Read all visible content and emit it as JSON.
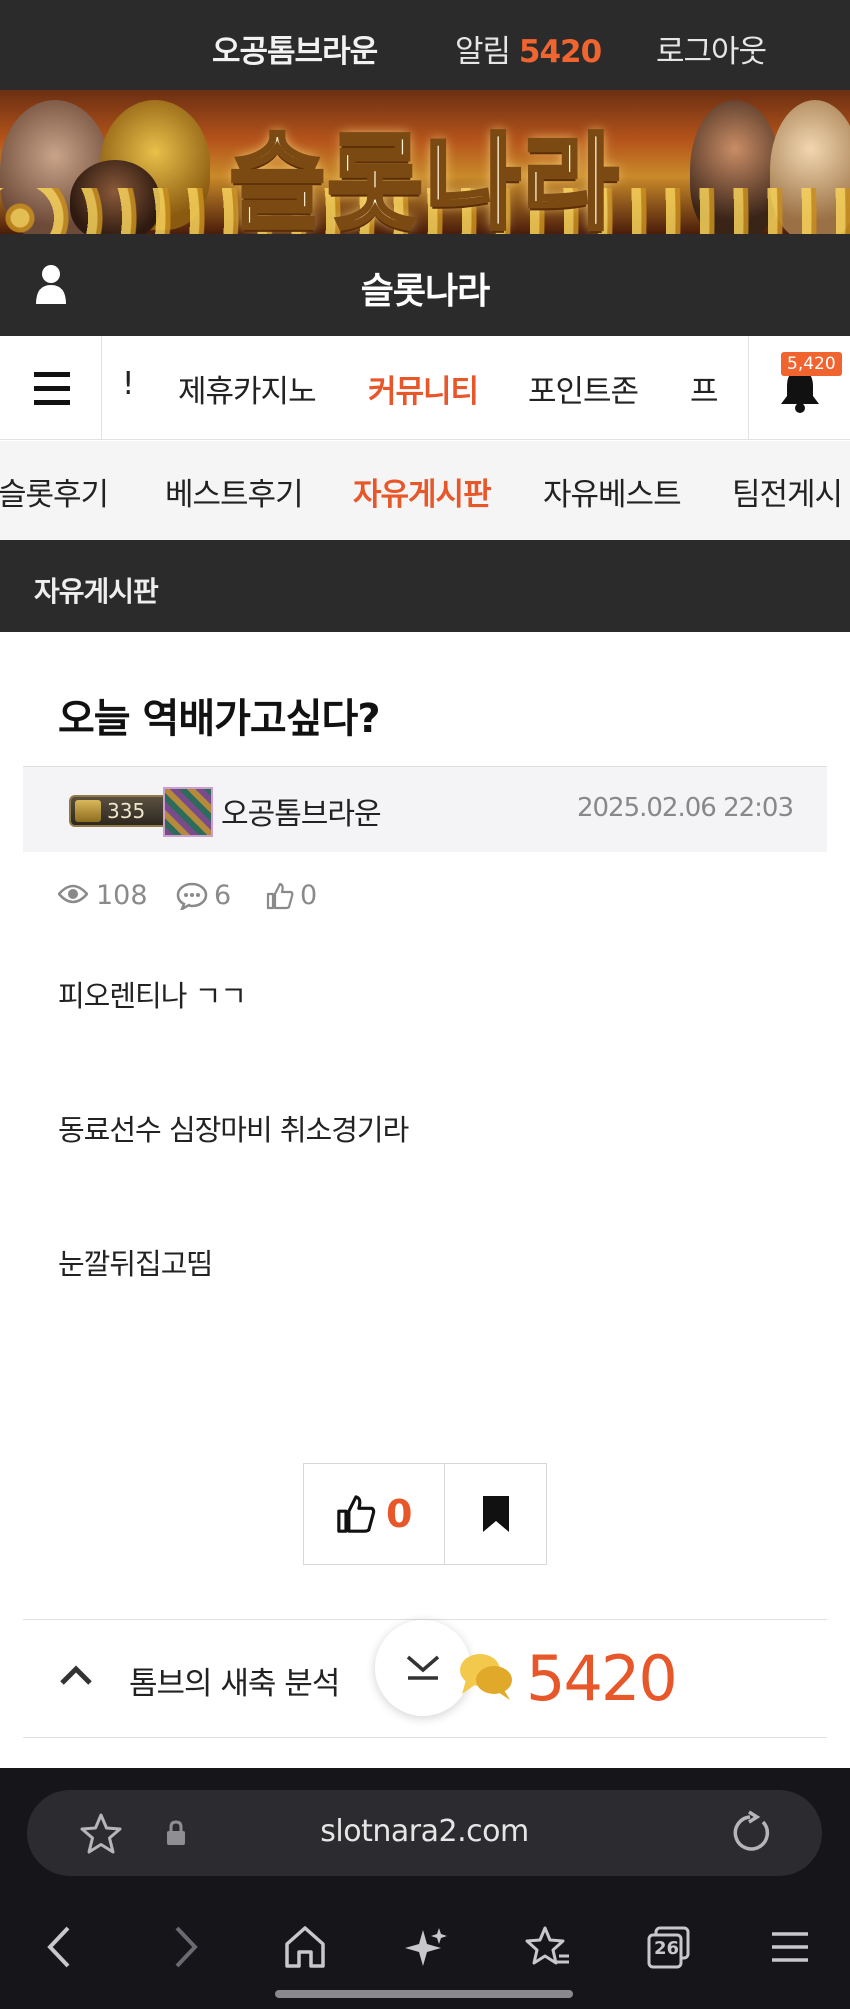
{
  "topbar": {
    "nickname": "오공톰브라운",
    "alarm_label": "알림",
    "alarm_count": "5420",
    "logout": "로그아웃"
  },
  "banner": {
    "title": "슬롯나라"
  },
  "header": {
    "site_title": "슬롯나라"
  },
  "main_nav": {
    "items": [
      "!",
      "제휴카지노",
      "커뮤니티",
      "포인트존",
      "프"
    ],
    "active": "커뮤니티",
    "bell_badge": "5,420"
  },
  "sub_nav": {
    "items": [
      "슬롯후기",
      "베스트후기",
      "자유게시판",
      "자유베스트",
      "팀전게시"
    ],
    "active": "자유게시판"
  },
  "board": {
    "title": "자유게시판"
  },
  "post": {
    "title": "오늘 역배가고싶다?",
    "level": "335",
    "author": "오공톰브라운",
    "date": "2025.02.06 22:03",
    "views": "108",
    "comments": "6",
    "likes": "0",
    "body": [
      "피오렌티나 ㄱㄱ",
      "동료선수 심장마비 취소경기라",
      "눈깔뒤집고띰"
    ]
  },
  "actions": {
    "like_count": "0"
  },
  "related": {
    "title": "톰브의 새축 분석"
  },
  "chat_float": {
    "count": "5420"
  },
  "browser": {
    "url": "slotnara2.com",
    "tabs_count": "26"
  },
  "colors": {
    "accent": "#e8572a",
    "dark_bar": "#2b2b2b",
    "browser_bg": "#16161a"
  },
  "icons": [
    "user-icon",
    "menu-icon",
    "bell-icon",
    "eye-icon",
    "comment-icon",
    "thumbs-up-icon",
    "bookmark-icon",
    "chevron-up-icon",
    "chevron-down-icon",
    "chat-icon",
    "star-icon",
    "lock-icon",
    "reload-icon",
    "back-icon",
    "forward-icon",
    "home-icon",
    "sparkle-icon",
    "bookmarks-icon",
    "tabs-icon",
    "hamburger-icon"
  ]
}
